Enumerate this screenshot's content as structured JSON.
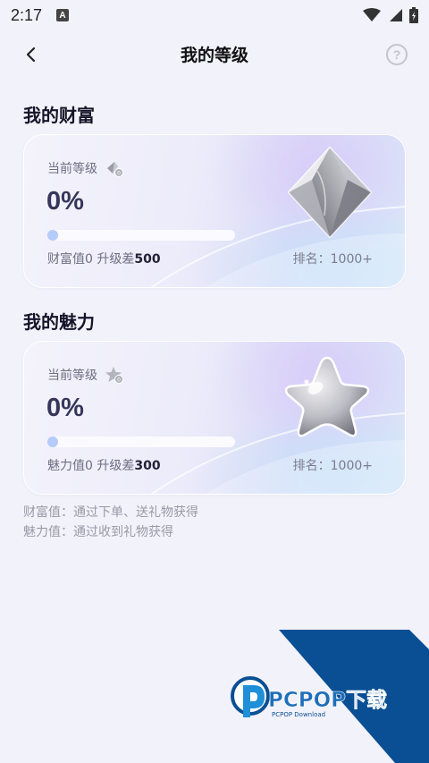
{
  "status_bar": {
    "time": "2:17",
    "a_icon": "A"
  },
  "header": {
    "title": "我的等级",
    "help": "?"
  },
  "wealth": {
    "section_title": "我的财富",
    "level_label": "当前等级",
    "percent": "0%",
    "progress": 0,
    "diff_prefix": "财富值0 升级差",
    "diff_value": "500",
    "rank": "排名：1000+",
    "icon": "silver-diamond-icon"
  },
  "charm": {
    "section_title": "我的魅力",
    "level_label": "当前等级",
    "percent": "0%",
    "progress": 0,
    "diff_prefix": "魅力值0 升级差",
    "diff_value": "300",
    "rank": "排名：1000+",
    "icon": "silver-star-icon"
  },
  "notes": {
    "wealth_note": "财富值：通过下单、送礼物获得",
    "charm_note": "魅力值：通过收到礼物获得"
  },
  "watermark": {
    "brand": "PCPOP下载",
    "sub": "PCPOP Download"
  },
  "colors": {
    "background": "#f2f2fa",
    "progress": "#b9cdfa",
    "watermark_blue": "#0a4f94"
  }
}
